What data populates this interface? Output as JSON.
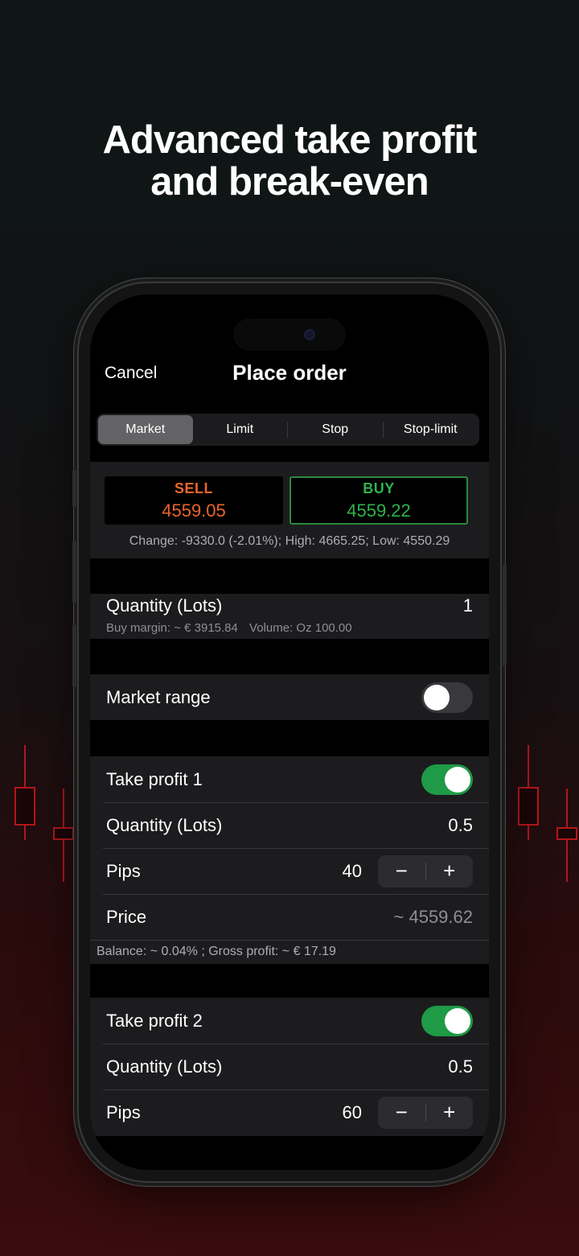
{
  "headline": {
    "line1": "Advanced take profit",
    "line2": "and break-even"
  },
  "nav": {
    "cancel": "Cancel",
    "title": "Place order"
  },
  "order_types": [
    "Market",
    "Limit",
    "Stop",
    "Stop-limit"
  ],
  "order_type_selected": "Market",
  "quote": {
    "sell_label": "SELL",
    "sell_price": "4559.05",
    "buy_label": "BUY",
    "buy_price": "4559.22",
    "info": "Change: -9330.0 (-2.01%); High: 4665.25; Low: 4550.29"
  },
  "quantity": {
    "label": "Quantity (Lots)",
    "value": "1",
    "margin": "Buy margin: ~ € 3915.84",
    "volume": "Volume: Oz 100.00"
  },
  "market_range": {
    "label": "Market range",
    "enabled": false
  },
  "take_profit_1": {
    "label": "Take profit 1",
    "enabled": true,
    "qty_label": "Quantity (Lots)",
    "qty_value": "0.5",
    "pips_label": "Pips",
    "pips_value": "40",
    "price_label": "Price",
    "price_value": "~ 4559.62",
    "note": "Balance: ~ 0.04% ; Gross profit: ~ € 17.19"
  },
  "take_profit_2": {
    "label": "Take profit 2",
    "enabled": true,
    "qty_label": "Quantity (Lots)",
    "qty_value": "0.5",
    "pips_label": "Pips",
    "pips_value": "60"
  },
  "stepper": {
    "minus": "−",
    "plus": "+"
  },
  "colors": {
    "sell": "#e8652b",
    "buy": "#2fb24a",
    "toggle_on": "#1f9a46",
    "candle": "#b5161a"
  },
  "icons": [
    "candlestick-decoration"
  ]
}
